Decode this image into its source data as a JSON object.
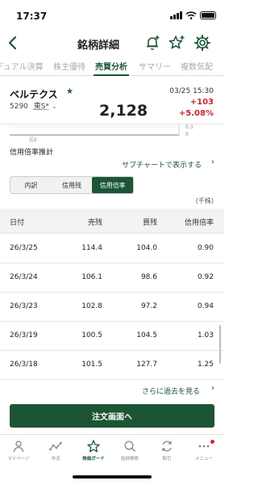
{
  "status_bar": {
    "time": "17:37"
  },
  "header": {
    "title": "銘柄詳細"
  },
  "tabs": [
    {
      "label": "デュアル決算"
    },
    {
      "label": "株主優待"
    },
    {
      "label": "売買分析"
    },
    {
      "label": "サマリー"
    },
    {
      "label": "複数気配"
    }
  ],
  "stock": {
    "name": "ベルテクス",
    "code": "5290",
    "market": "東S*",
    "price": "2,128",
    "datetime": "03/25 15:30",
    "change": "+103",
    "change_pct": "+5.08%"
  },
  "chart_remnant": {
    "y_top": "0.3",
    "y_zero": "0",
    "x_label": "3/2"
  },
  "section": {
    "title": "信用倍率推計",
    "subchart_link": "サブチャートで表示する",
    "segments": [
      "内訳",
      "信用残",
      "信用倍率"
    ],
    "active_segment": 2,
    "unit": "(千株)"
  },
  "table": {
    "headers": [
      "日付",
      "売残",
      "買残",
      "信用倍率"
    ],
    "rows": [
      {
        "date": "26/3/25",
        "sell": "114.4",
        "buy": "104.0",
        "ratio": "0.90"
      },
      {
        "date": "26/3/24",
        "sell": "106.1",
        "buy": "98.6",
        "ratio": "0.92"
      },
      {
        "date": "26/3/23",
        "sell": "102.8",
        "buy": "97.2",
        "ratio": "0.94"
      },
      {
        "date": "26/3/19",
        "sell": "100.5",
        "buy": "104.5",
        "ratio": "1.03"
      },
      {
        "date": "26/3/18",
        "sell": "101.5",
        "buy": "127.7",
        "ratio": "1.25"
      }
    ]
  },
  "more_link": "さらに過去を見る",
  "order_button": "注文画面へ",
  "bottom_nav": [
    {
      "label": "マイページ",
      "icon": "person-icon"
    },
    {
      "label": "市況",
      "icon": "market-icon"
    },
    {
      "label": "株価ボード",
      "icon": "star-icon"
    },
    {
      "label": "銘柄検索",
      "icon": "search-icon"
    },
    {
      "label": "取引",
      "icon": "trade-icon"
    },
    {
      "label": "メニュー",
      "icon": "menu-icon"
    }
  ],
  "colors": {
    "accent": "#1c5535",
    "up": "#c4262e"
  }
}
